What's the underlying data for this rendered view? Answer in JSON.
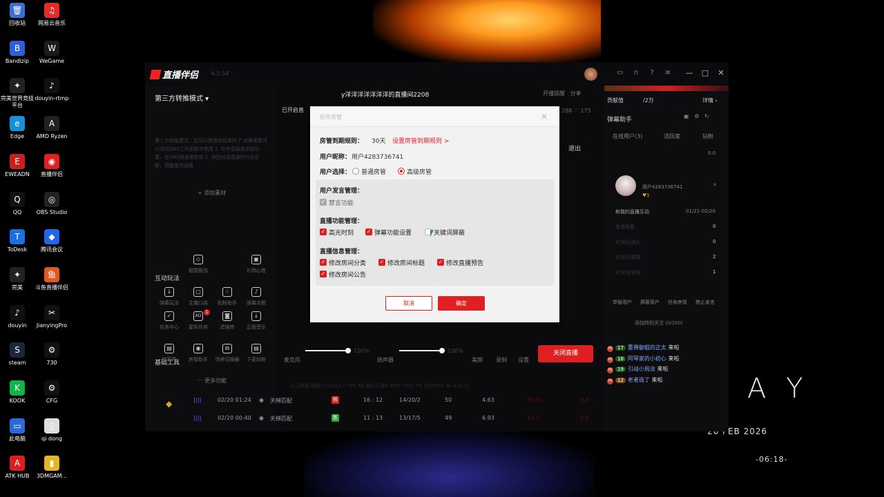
{
  "desktop": {
    "icons": [
      {
        "label": "回收站",
        "color": "#3b6fd1",
        "glyph": "🗑"
      },
      {
        "label": "网易云音乐",
        "color": "#e22b2b",
        "glyph": "♫"
      },
      {
        "label": "Bandizip",
        "color": "#2f5fd6",
        "glyph": "B"
      },
      {
        "label": "WeGame",
        "color": "#1b1b1b",
        "glyph": "W"
      },
      {
        "label": "完美世界竞技平台",
        "color": "#222222",
        "glyph": "✦"
      },
      {
        "label": "douyin-rtmp",
        "color": "#111111",
        "glyph": "♪"
      },
      {
        "label": "Edge",
        "color": "#1a8fd8",
        "glyph": "e"
      },
      {
        "label": "AMD Ryzen",
        "color": "#222222",
        "glyph": "A"
      },
      {
        "label": "EWEADN",
        "color": "#c62020",
        "glyph": "E"
      },
      {
        "label": "直播伴侣",
        "color": "#e02020",
        "glyph": "◉"
      },
      {
        "label": "QQ",
        "color": "#111111",
        "glyph": "Q"
      },
      {
        "label": "OBS Studio",
        "color": "#222222",
        "glyph": "◎"
      },
      {
        "label": "ToDesk",
        "color": "#1d6fe0",
        "glyph": "T"
      },
      {
        "label": "腾讯会议",
        "color": "#2464e8",
        "glyph": "◆"
      },
      {
        "label": "完美",
        "color": "#222222",
        "glyph": "✦"
      },
      {
        "label": "斗鱼直播伴侣",
        "color": "#e05a20",
        "glyph": "鱼"
      },
      {
        "label": "douyin",
        "color": "#111111",
        "glyph": "♪"
      },
      {
        "label": "JianyingPro",
        "color": "#111111",
        "glyph": "✂"
      },
      {
        "label": "steam",
        "color": "#1b2838",
        "glyph": "S"
      },
      {
        "label": "730",
        "color": "#111111",
        "glyph": "⚙"
      },
      {
        "label": "KOOK",
        "color": "#13b34b",
        "glyph": "K"
      },
      {
        "label": "CFG",
        "color": "#111111",
        "glyph": "⚙"
      },
      {
        "label": "此电脑",
        "color": "#2a6ad6",
        "glyph": "▭"
      },
      {
        "label": "qi dong",
        "color": "#dddddd",
        "glyph": "▯"
      },
      {
        "label": "ATK HUB",
        "color": "#d82020",
        "glyph": "A"
      },
      {
        "label": "3DMGAM...",
        "color": "#e5b52a",
        "glyph": "▮"
      }
    ],
    "brand": "A Y",
    "date": "20 FEB 2026",
    "time": "-06:18-"
  },
  "app": {
    "name": "直播伴侣",
    "version": "6.5.54",
    "mode_label": "第三方转推模式 ▾",
    "blurred_help": "第三方转推模式，您可以使用伴侣素材了 如果需要可以添加OBS工作室数中使用 1. 在伴侣画面添加设置，在OBS频道里数效 2. 添加对话音源所外标形数，调整推流设置",
    "add_material": "+ 添加素材",
    "section_interact": "互动玩法",
    "interact_tools": [
      {
        "label": "福盟挑战",
        "glyph": "◇"
      },
      {
        "label": "礼物心愿",
        "glyph": "▣"
      },
      {
        "label": "弹幕玩法",
        "glyph": "↓"
      },
      {
        "label": "主播口袋",
        "glyph": "▢"
      },
      {
        "label": "贴粉助手",
        "glyph": "♢"
      },
      {
        "label": "弹幕点歌",
        "glyph": "♪"
      }
    ],
    "section_basic": "基础工具",
    "basic_tools": [
      {
        "label": "任务中心",
        "glyph": "✓"
      },
      {
        "label": "星际任务",
        "glyph": "AD"
      },
      {
        "label": "滤镜商",
        "glyph": "◙"
      },
      {
        "label": "正版音乐",
        "glyph": "↓"
      },
      {
        "label": "弹幕秀",
        "glyph": "▤"
      },
      {
        "label": "房管助手",
        "glyph": "◉"
      },
      {
        "label": "场景切换器",
        "glyph": "⧉"
      },
      {
        "label": "下麦钩射",
        "glyph": "▤"
      }
    ],
    "basic_badge": "1",
    "more_features": "··· 更多功能",
    "room_name": "y洋洋洋洋洋洋洋的直播间2208",
    "started": "已开启直",
    "top_actions": [
      "开播提醒",
      "分享"
    ],
    "stats": "288  ♡ 175",
    "exit": "退出",
    "mic_label": "麦克风",
    "mic_percent": "100%",
    "mic_level": 1.0,
    "speaker_label": "扬声器",
    "speaker_percent": "100%",
    "speaker_level": 1.0,
    "ctrl_labels": [
      "美颜",
      "录制",
      "设置"
    ],
    "close_live": "关闭直播",
    "table_head": "心心阿姐  播放1000/11 ×    FPS 60   最比比最0.69%   CPU17%   内存52%   帧 ≤26 %",
    "history_rows": [
      {
        "time": "02/20 01:24",
        "mode": "天梯匹配",
        "result": "败",
        "result_color": "#d82020",
        "score": "16 : 12",
        "kda": "14/20/2",
        "n1": "50",
        "n2": "4.63",
        "n3": "10.01",
        "n4": "8.8"
      },
      {
        "time": "02/20 00:40",
        "mode": "天梯匹配",
        "result": "胜",
        "result_color": "#1fa83a",
        "score": "11 : 13",
        "kda": "13/17/5",
        "n1": "49",
        "n2": "6.93",
        "n3": "10.0",
        "n4": "8.8"
      }
    ]
  },
  "right_panel": {
    "contrib_label": "贡献值",
    "contrib_value": "/2万",
    "details": "详情 ›",
    "assistant_title": "弹幕助手",
    "tabs": [
      "在线用户(3)",
      "活跃度",
      "钻粉"
    ],
    "user_name": "用户4283736741",
    "user_badge": "♥1",
    "interact_title": "和我的直播互动",
    "interact_range": "01/21-02/20",
    "interact_rows": [
      {
        "label": "本场观看",
        "value": "0"
      },
      {
        "label": "近30日送礼",
        "value": "0"
      },
      {
        "label": "近30日观看",
        "value": "2"
      },
      {
        "label": "近30日评论",
        "value": "1"
      }
    ],
    "actions": [
      "举报用户",
      "屏蔽用户",
      "任命房管",
      "禁止发言"
    ],
    "add_follow": "添加特别关注 (0/200)",
    "score_small": "0.0",
    "chat": [
      {
        "level": "17",
        "name": "董佛御姐的正太",
        "msg": "来啦",
        "orange": false
      },
      {
        "level": "18",
        "name": "阿琴家的小初心",
        "msg": "来啦",
        "orange": false
      },
      {
        "level": "19",
        "name": "引战小局淡",
        "msg": "来啦",
        "orange": false
      },
      {
        "level": "12",
        "name": "老者造了",
        "msg": "来啦",
        "orange": true
      }
    ]
  },
  "dialog": {
    "title": "任命房管",
    "expiry_label": "房管到期规则：",
    "expiry_value": "30天",
    "expiry_link": "设置房管到期规则 >",
    "nickname_label": "用户昵称：",
    "nickname_value": "用户4283736741",
    "choice_label": "用户选择：",
    "choice_normal": "普通房管",
    "choice_advanced": "高级房管",
    "speech_title": "用户发言管理：",
    "speech_items": [
      "禁言功能"
    ],
    "function_title": "直播功能管理：",
    "function_items": [
      "高光时刻",
      "弹幕功能设置",
      "关键词屏蔽"
    ],
    "info_title": "直播信息管理：",
    "info_items": [
      "修改房间分类",
      "修改房间标题",
      "修改直播预告",
      "修改房间公告"
    ],
    "cancel": "取消",
    "ok": "确定"
  }
}
